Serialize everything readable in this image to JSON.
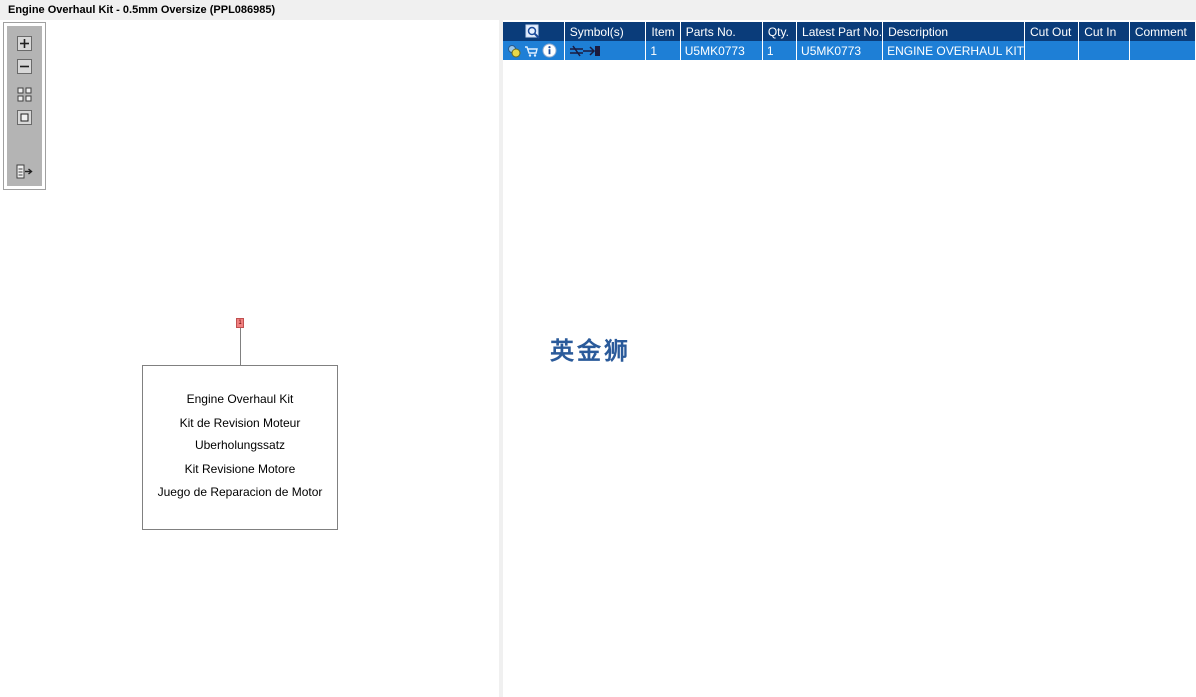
{
  "window": {
    "title": "Engine Overhaul Kit - 0.5mm Oversize (PPL086985)"
  },
  "toolbar": {
    "buttons": [
      {
        "icon": "zoom-in-icon"
      },
      {
        "icon": "zoom-out-icon"
      },
      {
        "icon": "fit-all-icon"
      },
      {
        "icon": "actual-size-icon"
      },
      {
        "icon": "export-icon"
      }
    ]
  },
  "diagram": {
    "callout": "1",
    "lines": [
      "Engine Overhaul Kit",
      "Kit de Revision Moteur",
      "Uberholungssatz",
      "Kit Revisione Motore",
      "Juego de Reparacion de Motor"
    ]
  },
  "table": {
    "headers": {
      "symbols": "Symbol(s)",
      "item": "Item",
      "parts_no": "Parts No.",
      "qty": "Qty.",
      "latest_part_no": "Latest Part No.",
      "description": "Description",
      "cut_out": "Cut Out",
      "cut_in": "Cut In",
      "comment": "Comment"
    },
    "rows": [
      {
        "item": "1",
        "parts_no": "U5MK0773",
        "qty": "1",
        "latest_part_no": "U5MK0773",
        "description": "ENGINE OVERHAUL KIT",
        "cut_out": "",
        "cut_in": "",
        "comment": ""
      }
    ],
    "colors": {
      "header": "#0a3c7a",
      "selected_row": "#1e7fd6"
    }
  },
  "watermark": "英金狮"
}
